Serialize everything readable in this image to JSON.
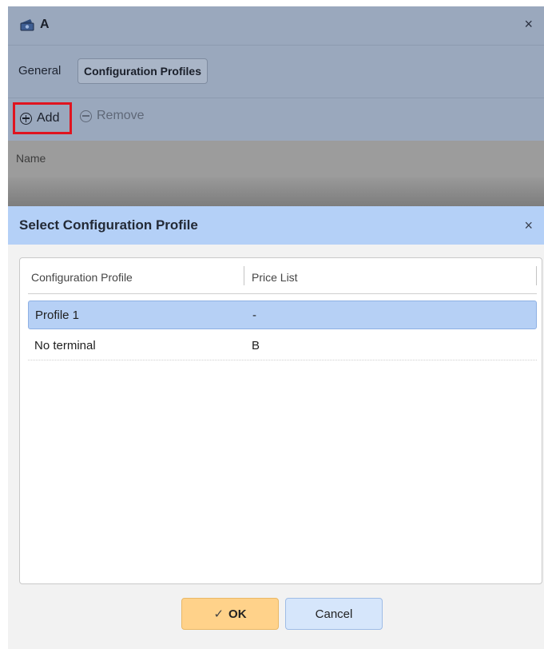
{
  "window": {
    "title": "A",
    "icon": "ticket-icon",
    "close_glyph": "×",
    "tabs": [
      {
        "label": "General",
        "selected": false
      },
      {
        "label": "Configuration Profiles",
        "selected": true
      }
    ],
    "toolbar": {
      "add_label": "Add",
      "remove_label": "Remove"
    },
    "grid": {
      "columns": [
        "Name"
      ]
    }
  },
  "dialog": {
    "title": "Select Configuration Profile",
    "close_glyph": "×",
    "table": {
      "columns": [
        "Configuration Profile",
        "Price List"
      ],
      "rows": [
        {
          "profile": "Profile 1",
          "price_list": "-",
          "selected": true
        },
        {
          "profile": "No terminal",
          "price_list": "B",
          "selected": false
        }
      ]
    },
    "buttons": {
      "ok_label": "OK",
      "ok_icon": "check-icon",
      "cancel_label": "Cancel"
    }
  },
  "colors": {
    "dialog_header": "#b4d0f7",
    "selected_row": "#b6d0f5",
    "ok_button": "#ffd28a",
    "cancel_button": "#d6e6fb",
    "highlight_box": "#e0141f"
  }
}
